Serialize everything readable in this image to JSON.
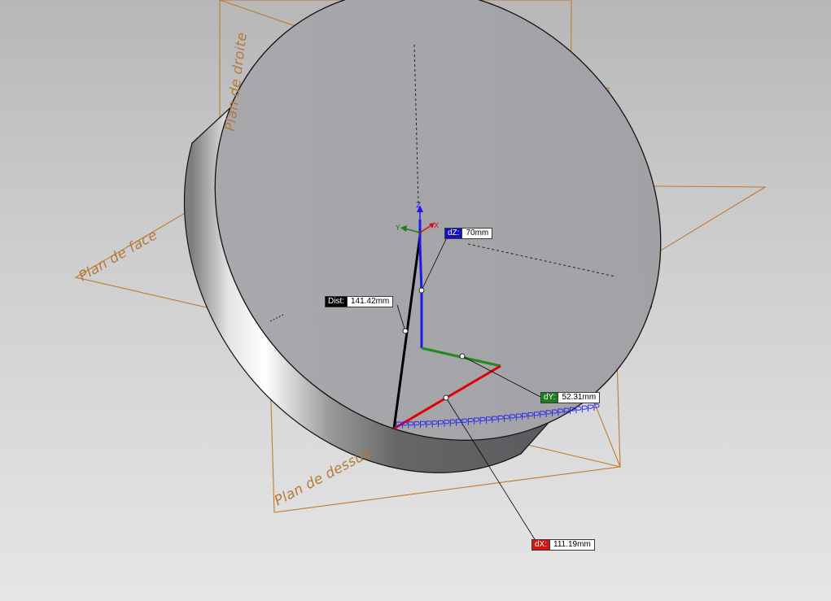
{
  "planes": {
    "right": "Plan de droite",
    "front": "Plan de face",
    "top": "Plan de dessus"
  },
  "triad": {
    "x": "X",
    "y": "Y",
    "z": "Z"
  },
  "callouts": {
    "dist": {
      "label": "Dist:",
      "value": "141.42mm"
    },
    "dz": {
      "label": "dZ:",
      "value": "70mm"
    },
    "dy": {
      "label": "dY:",
      "value": "52.31mm"
    },
    "dx": {
      "label": "dX:",
      "value": "111.19mm"
    }
  },
  "colors": {
    "plane_outline": "#c27a2e",
    "dx_axis": "#e00000",
    "dy_axis": "#1f8a1f",
    "dz_axis": "#1a1aee",
    "dist_line": "#000000",
    "dist_tag": "#000000",
    "dz_tag": "#1010c8",
    "dy_tag": "#1b7d1b",
    "dx_tag": "#d21515"
  }
}
